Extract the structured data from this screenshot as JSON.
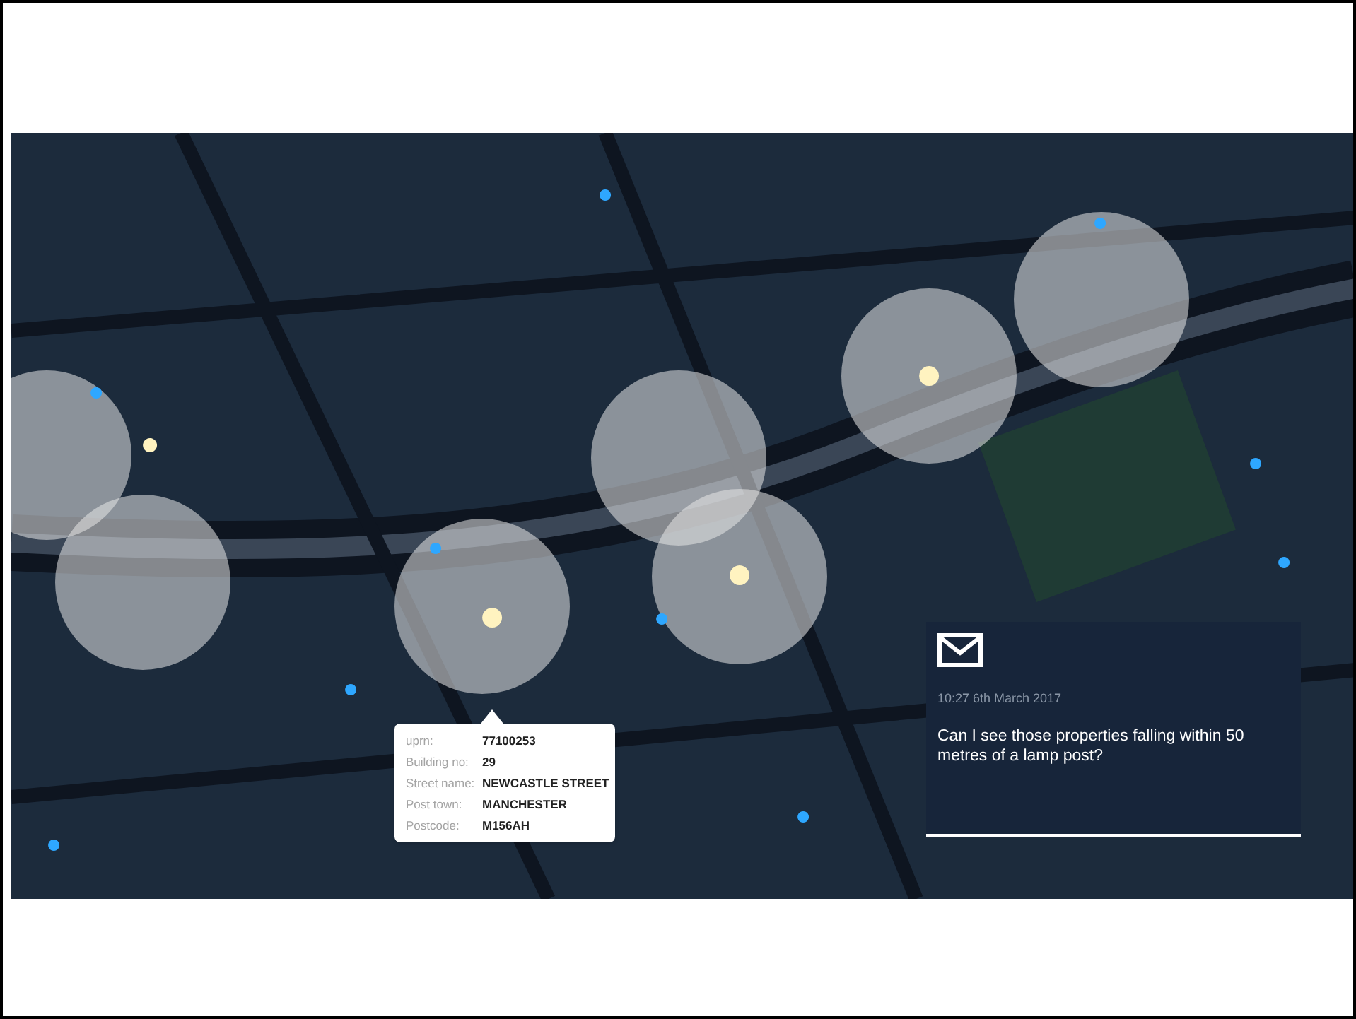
{
  "tooltip": {
    "fields": [
      {
        "label": "uprn:",
        "value": "77100253"
      },
      {
        "label": "Building no:",
        "value": "29"
      },
      {
        "label": "Street name:",
        "value": "NEWCASTLE STREET"
      },
      {
        "label": "Post town:",
        "value": "MANCHESTER"
      },
      {
        "label": "Postcode:",
        "value": "M156AH"
      }
    ]
  },
  "message": {
    "timestamp": "10:27 6th March 2017",
    "text": "Can I see those properties falling within 50 metres of a lamp post?"
  }
}
